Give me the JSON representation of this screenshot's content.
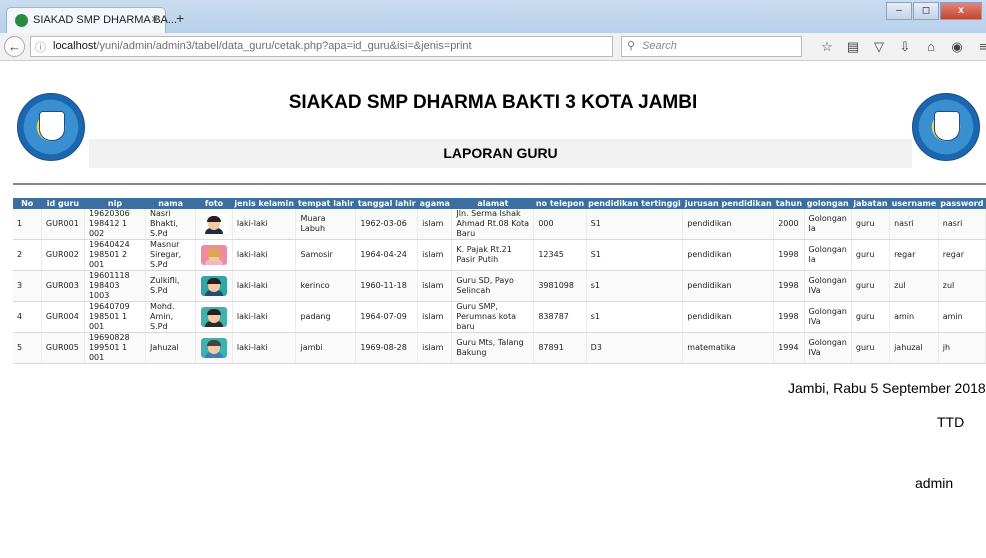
{
  "browser": {
    "tab_title": "SIAKAD SMP DHARMA BA...",
    "tab_close": "×",
    "new_tab": "+",
    "url_host": "localhost",
    "url_path": "/yuni/admin/admin3/tabel/data_guru/cetak.php?apa=id_guru&isi=&jenis=print",
    "search_placeholder": "Search",
    "window_buttons": {
      "minimize": "–",
      "maximize": "◻",
      "close": "x"
    }
  },
  "report": {
    "school_title": "SIAKAD SMP DHARMA BAKTI 3 KOTA JAMBI",
    "report_title": "LAPORAN GURU"
  },
  "table": {
    "headers": [
      "No",
      "id guru",
      "nip",
      "nama",
      "foto",
      "jenis kelamin",
      "tempat lahir",
      "tanggal lahir",
      "agama",
      "alamat",
      "no telepon",
      "pendidikan tertinggi",
      "jurusan pendidikan",
      "tahun",
      "golongan",
      "jabatan",
      "username",
      "password"
    ],
    "rows": [
      {
        "no": "1",
        "id_guru": "GUR001",
        "nip": "19620306 198412 1 002",
        "nama": "Nasri Bhakti, S.Pd",
        "jenis_kelamin": "laki-laki",
        "tempat_lahir": "Muara Labuh",
        "tanggal_lahir": "1962-03-06",
        "agama": "islam",
        "alamat": "Jln. Serma Ishak Ahmad Rt.08 Kota Baru",
        "no_telepon": "000",
        "pendidikan": "S1",
        "jurusan": "pendidikan",
        "tahun": "2000",
        "golongan": "Golongan Ia",
        "jabatan": "guru",
        "username": "nasri",
        "password": "nasri"
      },
      {
        "no": "2",
        "id_guru": "GUR002",
        "nip": "19640424 198501 2 001",
        "nama": "Masnur Siregar, S.Pd",
        "jenis_kelamin": "laki-laki",
        "tempat_lahir": "Samosir",
        "tanggal_lahir": "1964-04-24",
        "agama": "islam",
        "alamat": "K. Pajak Rt.21 Pasir Putih",
        "no_telepon": "12345",
        "pendidikan": "S1",
        "jurusan": "pendidikan",
        "tahun": "1998",
        "golongan": "Golongan Ia",
        "jabatan": "guru",
        "username": "regar",
        "password": "regar"
      },
      {
        "no": "3",
        "id_guru": "GUR003",
        "nip": "19601118 198403 1003",
        "nama": "Zulkifli, S.Pd",
        "jenis_kelamin": "laki-laki",
        "tempat_lahir": "kerinco",
        "tanggal_lahir": "1960-11-18",
        "agama": "islam",
        "alamat": "Guru SD, Payo Selincah",
        "no_telepon": "3981098",
        "pendidikan": "s1",
        "jurusan": "pendidikan",
        "tahun": "1998",
        "golongan": "Golongan IVa",
        "jabatan": "guru",
        "username": "zul",
        "password": "zul"
      },
      {
        "no": "4",
        "id_guru": "GUR004",
        "nip": "19640709 198501 1 001",
        "nama": "Mohd. Amin, S.Pd",
        "jenis_kelamin": "laki-laki",
        "tempat_lahir": "padang",
        "tanggal_lahir": "1964-07-09",
        "agama": "islam",
        "alamat": "Guru SMP, Perumnas kota baru",
        "no_telepon": "838787",
        "pendidikan": "s1",
        "jurusan": "pendidikan",
        "tahun": "1998",
        "golongan": "Golongan IVa",
        "jabatan": "guru",
        "username": "amin",
        "password": "amin"
      },
      {
        "no": "5",
        "id_guru": "GUR005",
        "nip": "19690828 199501 1 001",
        "nama": "Jahuzal",
        "jenis_kelamin": "laki-laki",
        "tempat_lahir": "jambi",
        "tanggal_lahir": "1969-08-28",
        "agama": "islam",
        "alamat": "Guru Mts, Talang Bakung",
        "no_telepon": "87891",
        "pendidikan": "D3",
        "jurusan": "matematika",
        "tahun": "1994",
        "golongan": "Golongan IVa",
        "jabatan": "guru",
        "username": "jahuzal",
        "password": "jh"
      }
    ]
  },
  "signature": {
    "date_line": "Jambi, Rabu 5 September 2018",
    "ttd": "TTD",
    "name": "admin"
  },
  "colors": {
    "header_bg": "#3c6fa0"
  }
}
